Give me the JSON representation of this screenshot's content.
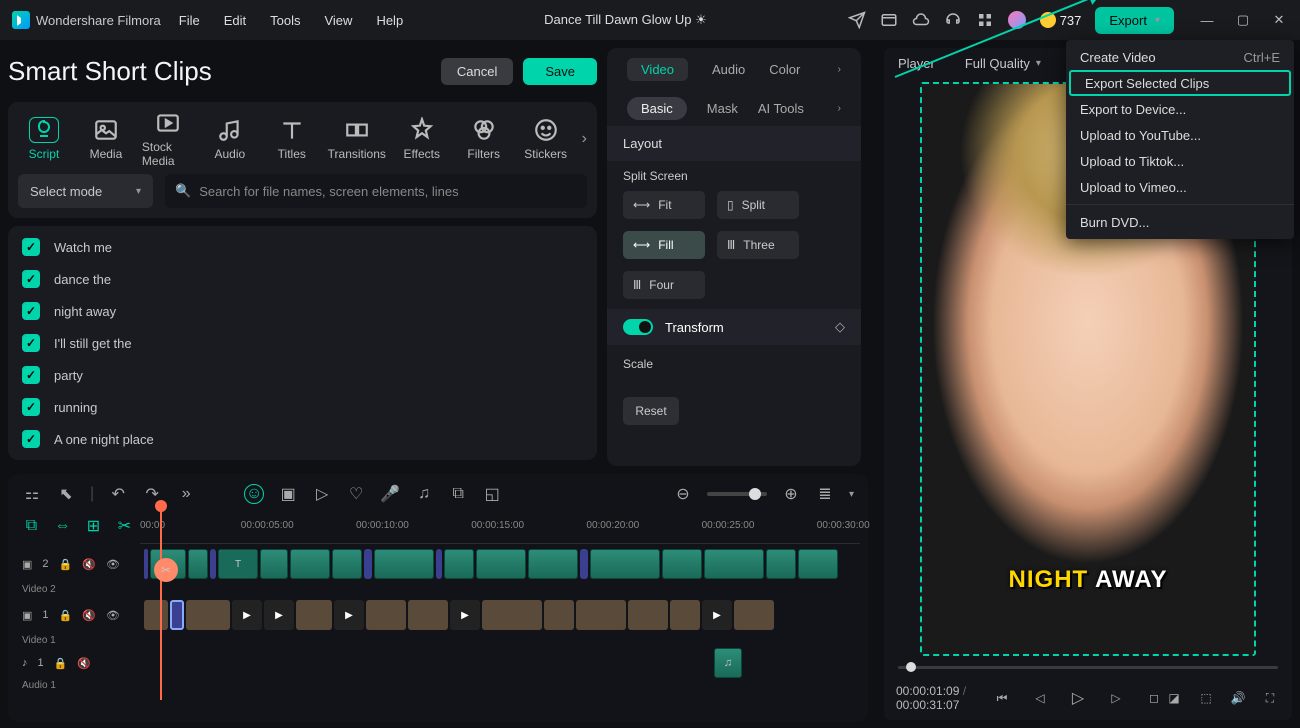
{
  "app": {
    "name": "Wondershare Filmora",
    "project": "Dance Till Dawn Glow Up ☀"
  },
  "menubar": {
    "file": "File",
    "edit": "Edit",
    "tools": "Tools",
    "view": "View",
    "help": "Help"
  },
  "credits": "737",
  "export": {
    "label": "Export",
    "menu": {
      "create": "Create Video",
      "create_sc": "Ctrl+E",
      "sel": "Export Selected Clips",
      "device": "Export to Device...",
      "yt": "Upload to YouTube...",
      "tt": "Upload to Tiktok...",
      "vm": "Upload to Vimeo...",
      "dvd": "Burn DVD..."
    }
  },
  "smart": {
    "title": "Smart Short Clips",
    "cancel": "Cancel",
    "save": "Save"
  },
  "tooltabs": {
    "script": "Script",
    "media": "Media",
    "stock": "Stock Media",
    "audio": "Audio",
    "titles": "Titles",
    "transitions": "Transitions",
    "effects": "Effects",
    "filters": "Filters",
    "stickers": "Stickers"
  },
  "selectmode": "Select mode",
  "search_ph": "Search for file names, screen elements, lines",
  "lines": [
    "Watch me",
    "dance the",
    "night away",
    "I'll still get the",
    "party",
    "running",
    "A one night place"
  ],
  "midtabs": {
    "video": "Video",
    "audio": "Audio",
    "color": "Color"
  },
  "subtabs": {
    "basic": "Basic",
    "mask": "Mask",
    "ai": "AI Tools"
  },
  "layout": {
    "label": "Layout",
    "split": "Split Screen",
    "fit": "Fit",
    "fill": "Fill",
    "splitb": "Split",
    "three": "Three",
    "four": "Four",
    "transform": "Transform",
    "scale": "Scale",
    "reset": "Reset"
  },
  "ruler": [
    "00:00",
    "00:00:05:00",
    "00:00:10:00",
    "00:00:15:00",
    "00:00:20:00",
    "00:00:25:00",
    "00:00:30:00"
  ],
  "tracks": {
    "v2": "Video 2",
    "v2n": "2",
    "v1": "Video 1",
    "v1n": "1",
    "a1": "Audio 1",
    "a1n": "1"
  },
  "preview": {
    "player": "Player",
    "quality": "Full Quality",
    "cap_w1": "NIGHT",
    "cap_w2": "AWAY",
    "cur": "00:00:01:09",
    "dur": "00:00:31:07"
  }
}
